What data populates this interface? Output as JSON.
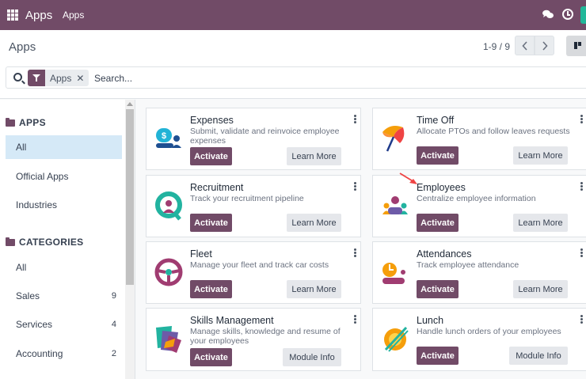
{
  "navbar": {
    "brand": "Apps",
    "menu_item": "Apps"
  },
  "control_panel": {
    "title": "Apps",
    "pager": "1-9 / 9"
  },
  "search": {
    "facet_label": "Apps",
    "facet_remove": "✕",
    "placeholder": "Search..."
  },
  "sidebar": {
    "apps_heading": "APPS",
    "apps_items": [
      {
        "label": "All",
        "active": true
      },
      {
        "label": "Official Apps"
      },
      {
        "label": "Industries"
      }
    ],
    "categories_heading": "CATEGORIES",
    "category_items": [
      {
        "label": "All",
        "count": ""
      },
      {
        "label": "Sales",
        "count": "9"
      },
      {
        "label": "Services",
        "count": "4"
      },
      {
        "label": "Accounting",
        "count": "2"
      }
    ]
  },
  "cards": [
    {
      "title": "Expenses",
      "desc": "Submit, validate and reinvoice employee expenses",
      "activate": "Activate",
      "secondary": "Learn More",
      "icon": "expenses-icon"
    },
    {
      "title": "Time Off",
      "desc": "Allocate PTOs and follow leaves requests",
      "activate": "Activate",
      "secondary": "Learn More",
      "icon": "time-off-icon"
    },
    {
      "title": "Recruitment",
      "desc": "Track your recruitment pipeline",
      "activate": "Activate",
      "secondary": "Learn More",
      "icon": "recruitment-icon"
    },
    {
      "title": "Employees",
      "desc": "Centralize employee information",
      "activate": "Activate",
      "secondary": "Learn More",
      "icon": "employees-icon"
    },
    {
      "title": "Fleet",
      "desc": "Manage your fleet and track car costs",
      "activate": "Activate",
      "secondary": "Learn More",
      "icon": "fleet-icon"
    },
    {
      "title": "Attendances",
      "desc": "Track employee attendance",
      "activate": "Activate",
      "secondary": "Learn More",
      "icon": "attendances-icon"
    },
    {
      "title": "Skills Management",
      "desc": "Manage skills, knowledge and resume of your employees",
      "activate": "Activate",
      "secondary": "Module Info",
      "icon": "skills-icon"
    },
    {
      "title": "Lunch",
      "desc": "Handle lunch orders of your employees",
      "activate": "Activate",
      "secondary": "Module Info",
      "icon": "lunch-icon"
    }
  ],
  "colors": {
    "brand": "#714b67",
    "active_bg": "#d5e9f7"
  }
}
